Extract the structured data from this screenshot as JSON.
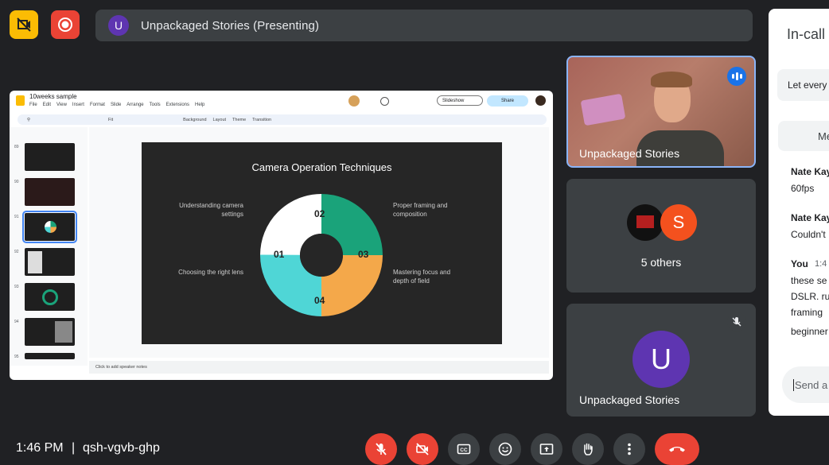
{
  "colors": {
    "bg": "#202124",
    "danger": "#ea4335",
    "surface": "#3c4043",
    "presenting_yellow": "#fbbc04"
  },
  "top": {
    "presenter_initial": "U",
    "title": "Unpackaged Stories (Presenting)"
  },
  "slides_app": {
    "doc_title": "10weeks sample",
    "menu": [
      "File",
      "Edit",
      "View",
      "Insert",
      "Format",
      "Slide",
      "Arrange",
      "Tools",
      "Extensions",
      "Help"
    ],
    "slideshow_label": "Slideshow",
    "share_label": "Share",
    "toolbar": [
      "Fit",
      "Background",
      "Layout",
      "Theme",
      "Transition"
    ],
    "thumb_numbers": [
      "89",
      "90",
      "91",
      "92",
      "93",
      "94",
      "95"
    ],
    "notes_placeholder": "Click to add speaker notes",
    "slide": {
      "title": "Camera Operation Techniques",
      "segments": [
        "01",
        "02",
        "03",
        "04"
      ],
      "captions": {
        "top_left": "Understanding camera settings",
        "bottom_left": "Choosing the right lens",
        "top_right": "Proper framing and composition",
        "bottom_right": "Mastering focus and depth of field"
      }
    }
  },
  "tiles": {
    "self_name": "Unpackaged Stories",
    "others_label": "5 others",
    "others_initial": "S",
    "presenter_initial": "U",
    "presenter_name": "Unpackaged Stories"
  },
  "panel": {
    "title": "In-call",
    "banner": "Let every",
    "tab": "Me",
    "messages": [
      {
        "author": "Nate Kay",
        "text": "60fps"
      },
      {
        "author": "Nate Kay",
        "text": "Couldn't"
      },
      {
        "author": "You",
        "time": "1:4",
        "lines": [
          "these se",
          "DSLR. ru",
          "framing",
          "beginner"
        ]
      }
    ],
    "send_placeholder": "Send a r"
  },
  "bottom": {
    "time": "1:46 PM",
    "separator": "|",
    "meeting_code": "qsh-vgvb-ghp"
  }
}
